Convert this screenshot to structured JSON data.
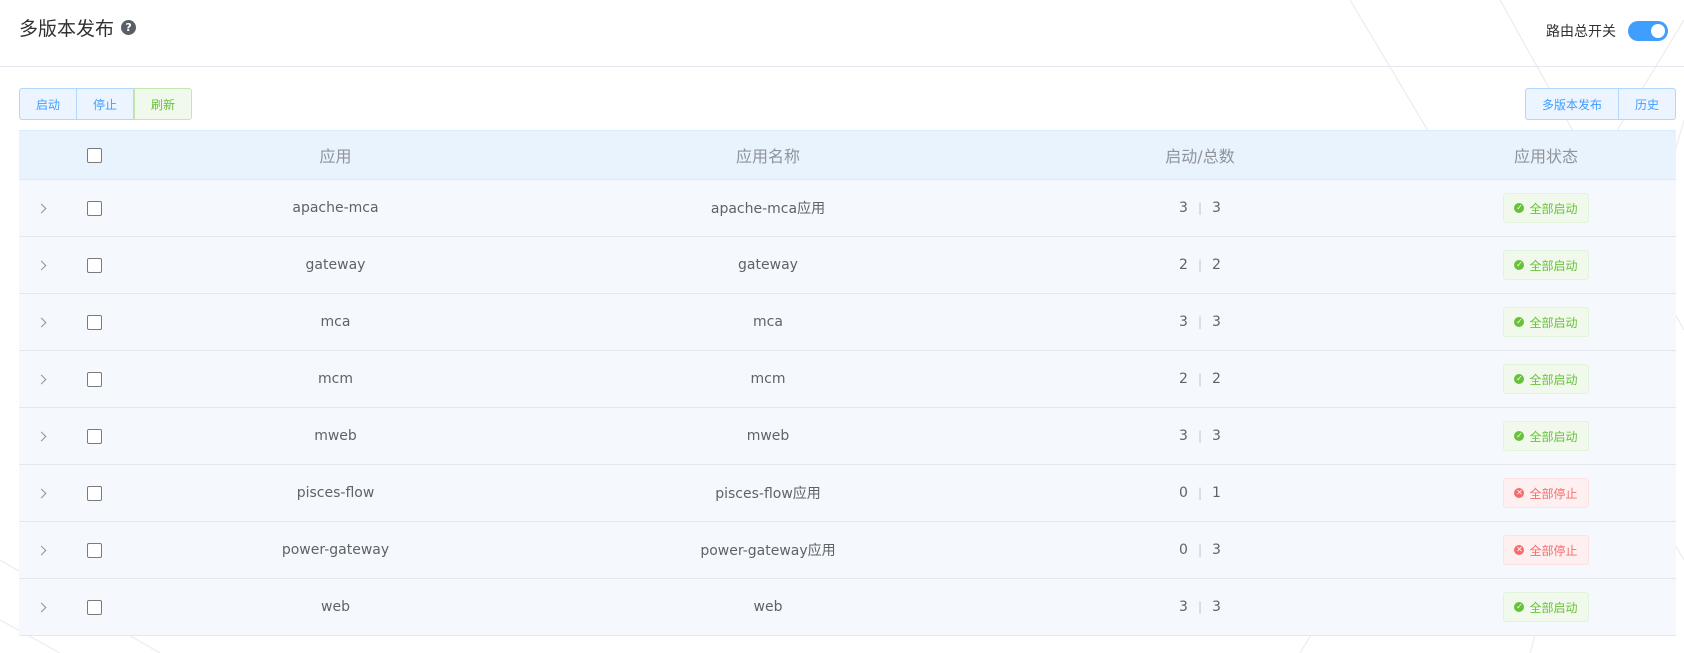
{
  "header": {
    "title": "多版本发布",
    "help_icon": "?",
    "route_switch_label": "路由总开关",
    "route_switch_on": true
  },
  "toolbar": {
    "left_buttons": [
      "启动",
      "停止",
      "刷新"
    ],
    "right_buttons": [
      "多版本发布",
      "历史"
    ]
  },
  "table": {
    "headers": [
      "应用",
      "应用名称",
      "启动/总数",
      "应用状态"
    ],
    "rows": [
      {
        "app": "apache-mca",
        "name": "apache-mca应用",
        "started": "3",
        "total": "3",
        "status": "全部启动",
        "status_type": "ok"
      },
      {
        "app": "gateway",
        "name": "gateway",
        "started": "2",
        "total": "2",
        "status": "全部启动",
        "status_type": "ok"
      },
      {
        "app": "mca",
        "name": "mca",
        "started": "3",
        "total": "3",
        "status": "全部启动",
        "status_type": "ok"
      },
      {
        "app": "mcm",
        "name": "mcm",
        "started": "2",
        "total": "2",
        "status": "全部启动",
        "status_type": "ok"
      },
      {
        "app": "mweb",
        "name": "mweb",
        "started": "3",
        "total": "3",
        "status": "全部启动",
        "status_type": "ok"
      },
      {
        "app": "pisces-flow",
        "name": "pisces-flow应用",
        "started": "0",
        "total": "1",
        "status": "全部停止",
        "status_type": "stop"
      },
      {
        "app": "power-gateway",
        "name": "power-gateway应用",
        "started": "0",
        "total": "3",
        "status": "全部停止",
        "status_type": "stop"
      },
      {
        "app": "web",
        "name": "web",
        "started": "3",
        "total": "3",
        "status": "全部启动",
        "status_type": "ok"
      }
    ]
  },
  "colors": {
    "primary": "#409eff",
    "success": "#67c23a",
    "danger": "#f56c6c"
  }
}
